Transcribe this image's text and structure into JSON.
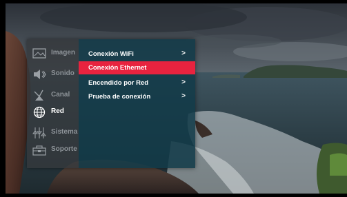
{
  "sidebar": {
    "items": [
      {
        "label": "Imagen",
        "icon": "picture-icon",
        "active": false
      },
      {
        "label": "Sonido",
        "icon": "speaker-icon",
        "active": false
      },
      {
        "label": "Canal",
        "icon": "antenna-icon",
        "active": false
      },
      {
        "label": "Red",
        "icon": "globe-icon",
        "active": true
      },
      {
        "label": "Sistema",
        "icon": "sliders-icon",
        "active": false
      },
      {
        "label": "Soporte",
        "icon": "toolbox-icon",
        "active": false
      }
    ]
  },
  "submenu": {
    "items": [
      {
        "label": "Conexión WiFi",
        "arrow": ">",
        "highlighted": false
      },
      {
        "label": "Conexión Ethernet",
        "arrow": "",
        "highlighted": true
      },
      {
        "label": "Encendido por Red",
        "arrow": ">",
        "highlighted": false
      },
      {
        "label": "Prueba de conexión",
        "arrow": ">",
        "highlighted": false
      }
    ]
  },
  "colors": {
    "highlight": "#e8233f",
    "submenu_bg": "#123a48",
    "sidebar_bg": "#34383c",
    "inactive_text": "#8d9398",
    "active_text": "#ffffff"
  }
}
